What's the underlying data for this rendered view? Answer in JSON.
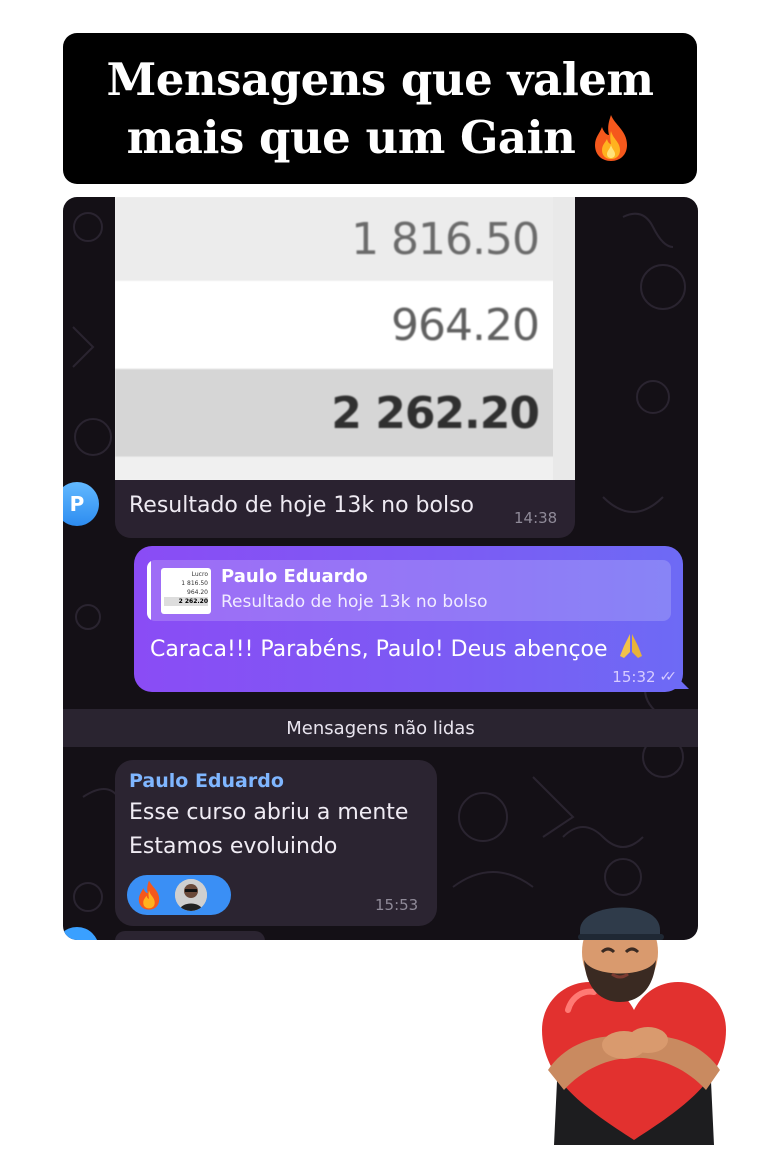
{
  "banner": {
    "title_line1": "Mensagens que valem",
    "title_line2": "mais que um Gain",
    "emoji_icon": "fire-icon"
  },
  "chat": {
    "image_message": {
      "image_values": [
        "1 816.50",
        "964.20",
        "2 262.20"
      ],
      "caption": "Resultado de hoje 13k no bolso",
      "time": "14:38",
      "sender_avatar_letter": "P"
    },
    "outgoing_message": {
      "reply_to": {
        "name": "Paulo Eduardo",
        "text": "Resultado de hoje 13k no bolso",
        "thumb_values": [
          "Lucro",
          "1 816.50",
          "964.20",
          "2 262.20"
        ]
      },
      "text": "Caraca!!! Parabéns, Paulo! Deus abençoe",
      "emoji_icon": "praying-hands-icon",
      "time": "15:32",
      "status_icon": "double-check-icon"
    },
    "unread_divider": "Mensagens não lidas",
    "incoming_message": {
      "sender": "Paulo Eduardo",
      "lines": [
        "Esse curso abriu a mente",
        "Estamos evoluindo"
      ],
      "reactions": [
        "fire-icon",
        "reactor-avatar"
      ],
      "time": "15:53"
    }
  },
  "colors": {
    "chat_background": "#141016",
    "outgoing_bubble": "#7b5cf4",
    "incoming_bubble": "#2b2431",
    "sender_name": "#7fb6ff",
    "reaction_pill": "#3a8ff5"
  }
}
